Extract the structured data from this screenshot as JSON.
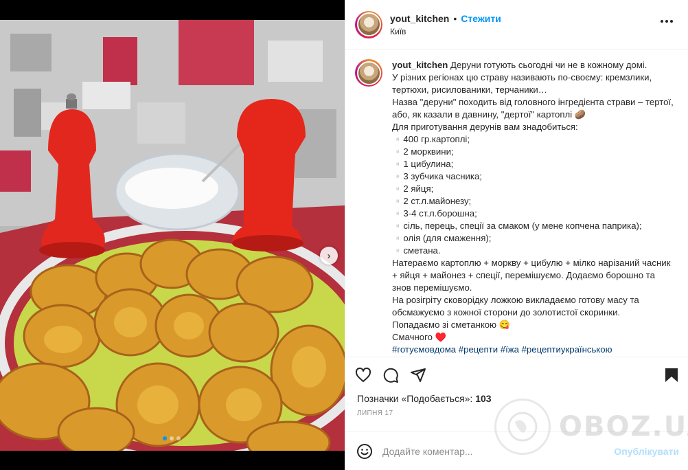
{
  "post": {
    "username": "yout_kitchen",
    "separator": "•",
    "follow_label": "Стежити",
    "location": "Київ"
  },
  "caption": {
    "username": "yout_kitchen",
    "text": "Деруни готують сьогодні чи не в кожному домі.\nУ різних регіонах цю страву називають по-своєму: кремзлики, тертюхи, рисилованики, терчаники…\nНазва \"деруни\" походить від головного інгредієнта страви – тертої, або, як казали в давнину, \"дертої\" картоплі 🥔\nДля приготування дерунів вам знадобиться:\n▫️400 гр.картоплі;\n▫️2 морквини;\n▫️1 цибулина;\n▫️3 зубчика часника;\n▫️2 яйця;\n▫️2 ст.л.майонезу;\n▫️3-4 ст.л.борошна;\n▫️сіль, перець, спеції за смаком (у мене копчена паприка);\n▫️олія (для смаження);\n▫️сметана.\nНатераємо картоплю + моркву + цибулю + мілко нарізаний часник + яйця + майонез + спеції, перемішуємо. Додаємо борошно та знов перемішуємо.\nНа розігріту сковорідку ложкою викладаємо готову масу та обсмажуємо з кожної сторони до золотистої скоринки.\nПопадаємо зі сметанкою 😋\nСмачного ♥️\n",
    "hashtags": [
      "#готуємовдома",
      "#рецепти",
      "#їжа",
      "#рецептиукраїнською"
    ]
  },
  "likes": {
    "label": "Позначки «Подобається»:",
    "count": "103"
  },
  "date": "ЛИПНЯ 17",
  "comment": {
    "placeholder": "Додайте коментар...",
    "publish_label": "Опублікувати"
  },
  "watermark": {
    "text": "OBOZ.UA"
  },
  "carousel": {
    "slides": 3,
    "active": 1
  },
  "icons": {
    "more": "more-options-icon",
    "like": "heart-icon",
    "comment": "comment-icon",
    "share": "share-icon",
    "save": "bookmark-icon",
    "emoji": "emoji-icon",
    "next": "chevron-right-icon"
  },
  "colors": {
    "accent": "#0095f6",
    "text": "#262626",
    "muted": "#8e8e8e",
    "hashtag": "#00376b",
    "publish_disabled": "#b2dffc"
  }
}
